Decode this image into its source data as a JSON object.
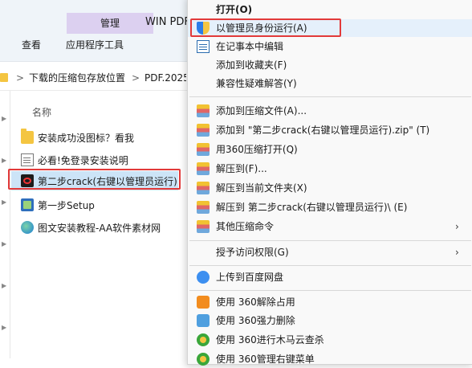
{
  "ribbon": {
    "context_tab": "管理",
    "title_partial": "WIN PDF",
    "view_label": "查看",
    "app_tools_label": "应用程序工具"
  },
  "address": {
    "crumbs": [
      "下载的压缩包存放位置",
      "PDF.2025"
    ],
    "separator": ">"
  },
  "file_list": {
    "column_name": "名称",
    "items": [
      {
        "label": "安装成功没图标？看我",
        "icon": "folder-icon"
      },
      {
        "label": "必看!免登录安装说明",
        "icon": "document-icon"
      },
      {
        "label": "第二步crack(右键以管理员运行)",
        "icon": "pdf-app-icon",
        "selected": true
      },
      {
        "label": "第一步Setup",
        "icon": "setup-icon"
      },
      {
        "label": "图文安装教程-AA软件素材网",
        "icon": "web-link-icon"
      }
    ]
  },
  "context_menu": {
    "items": [
      {
        "label": "打开(O)",
        "bold": true
      },
      {
        "label": "以管理员身份运行(A)",
        "icon": "uac-shield-icon",
        "highlighted": true
      },
      {
        "label": "在记事本中编辑",
        "icon": "notepad-icon"
      },
      {
        "label": "添加到收藏夹(F)"
      },
      {
        "label": "兼容性疑难解答(Y)"
      },
      {
        "label": "添加到压缩文件(A)...",
        "icon": "archive-icon"
      },
      {
        "label": "添加到 \"第二步crack(右键以管理员运行).zip\" (T)",
        "icon": "archive-icon"
      },
      {
        "label": "用360压缩打开(Q)",
        "icon": "archive-icon"
      },
      {
        "label": "解压到(F)...",
        "icon": "archive-icon"
      },
      {
        "label": "解压到当前文件夹(X)",
        "icon": "archive-icon"
      },
      {
        "label": "解压到 第二步crack(右键以管理员运行)\\ (E)",
        "icon": "archive-icon"
      },
      {
        "label": "其他压缩命令",
        "icon": "archive-icon",
        "submenu": true
      },
      {
        "label": "授予访问权限(G)",
        "submenu": true
      },
      {
        "label": "上传到百度网盘",
        "icon": "baidu-cloud-icon"
      },
      {
        "label": "使用 360解除占用",
        "icon": "360-icon"
      },
      {
        "label": "使用 360强力删除",
        "icon": "360-icon"
      },
      {
        "label": "使用 360进行木马云查杀",
        "icon": "360-icon"
      },
      {
        "label": "使用 360管理右键菜单",
        "icon": "360-icon"
      }
    ],
    "submenu_arrow": "›"
  },
  "colors": {
    "highlight_border": "#e23a3a",
    "context_tab_bg": "#dcd0f0",
    "selection_bg": "#cce4f7"
  }
}
